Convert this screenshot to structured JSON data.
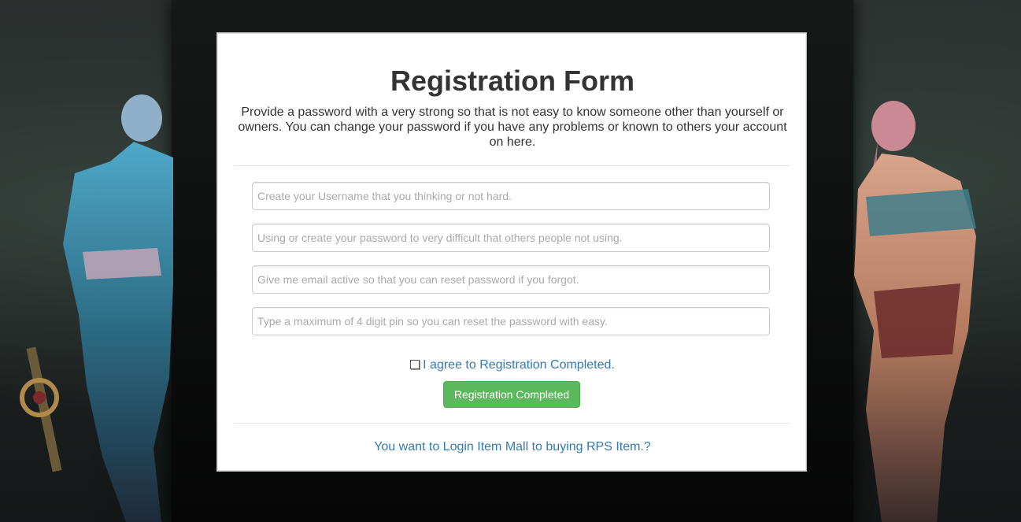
{
  "form": {
    "title": "Registration Form",
    "description": "Provide a password with a very strong so that is not easy to know someone other than yourself or owners. You can change your password if you have any problems or known to others your account on here.",
    "fields": {
      "username_placeholder": "Create your Username that you thinking or not hard.",
      "password_placeholder": "Using or create your password to very difficult that others people not using.",
      "email_placeholder": "Give me email active so that you can reset password if you forgot.",
      "pin_placeholder": "Type a maximum of 4 digit pin so you can reset the password with easy."
    },
    "agree_label": "I agree to Registration Completed.",
    "submit_label": "Registration Completed",
    "login_link": "You want to Login Item Mall to buying RPS Item.?"
  },
  "colors": {
    "accent_link": "#337ab7",
    "button_success": "#5cb85c",
    "background_dark": "#1b1e1e"
  }
}
